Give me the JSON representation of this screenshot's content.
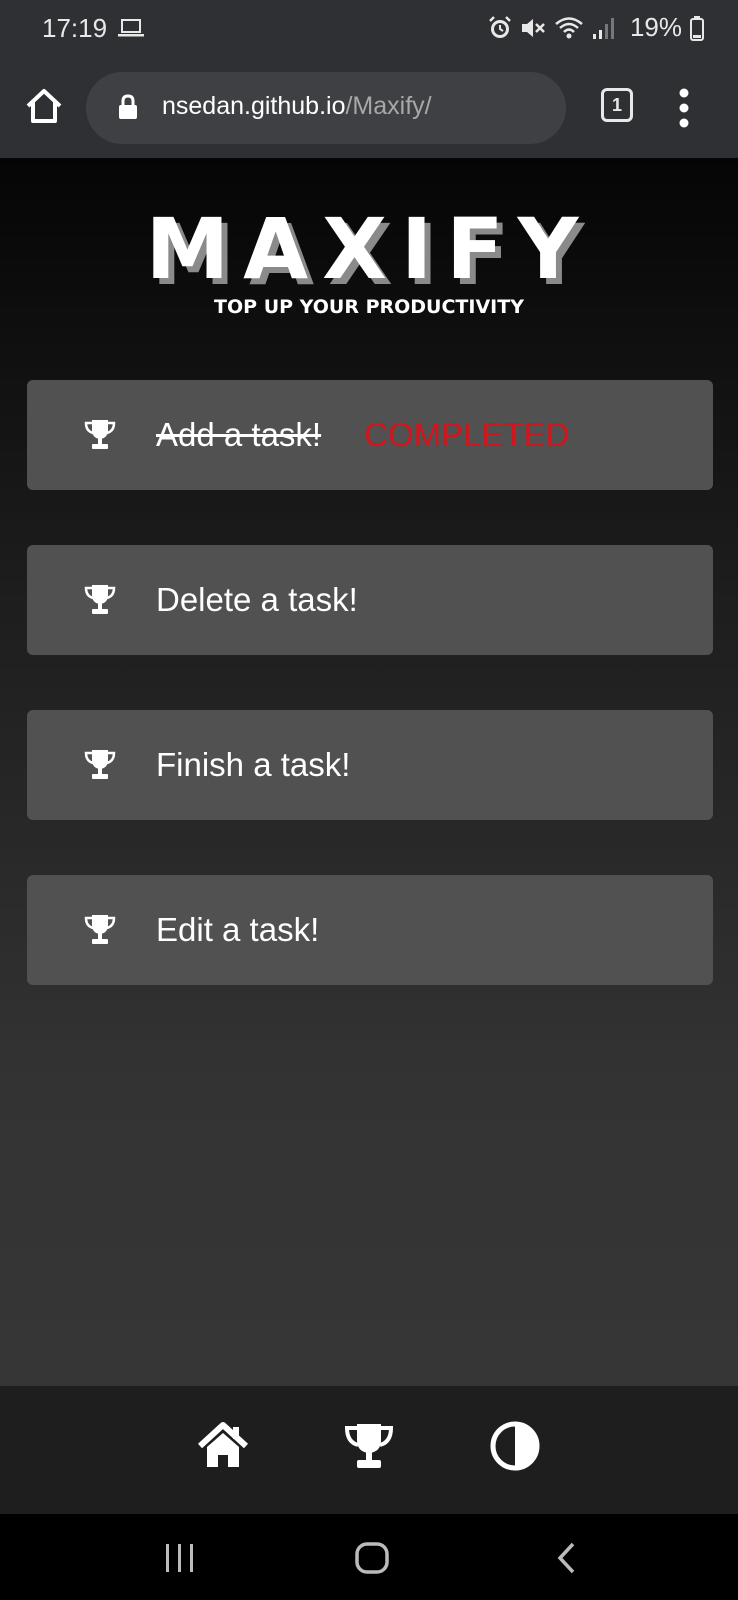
{
  "status_bar": {
    "time": "17:19",
    "battery": "19%",
    "icons": [
      "laptop-icon",
      "alarm-icon",
      "mute-icon",
      "wifi-icon",
      "signal-icon",
      "battery-icon"
    ]
  },
  "browser": {
    "url_host": "nsedan.github.io",
    "url_path": "/Maxify/",
    "tab_count": "1",
    "icons": [
      "home-icon",
      "lock-icon",
      "menu-dots-icon"
    ]
  },
  "app": {
    "logo": "MAXIFY",
    "tagline": "TOP UP YOUR PRODUCTIVITY",
    "tasks": [
      {
        "label": "Add a task!",
        "status": "COMPLETED",
        "done": true
      },
      {
        "label": "Delete a task!",
        "status": "",
        "done": false
      },
      {
        "label": "Finish a task!",
        "status": "",
        "done": false
      },
      {
        "label": "Edit a task!",
        "status": "",
        "done": false
      }
    ],
    "bottom_nav": [
      "home-icon",
      "trophy-icon",
      "contrast-icon"
    ]
  },
  "colors": {
    "completed": "#d0161d",
    "task_bg": "#515151",
    "chrome_bg": "#2f3033"
  },
  "system_nav": [
    "recents-icon",
    "home-icon",
    "back-icon"
  ]
}
